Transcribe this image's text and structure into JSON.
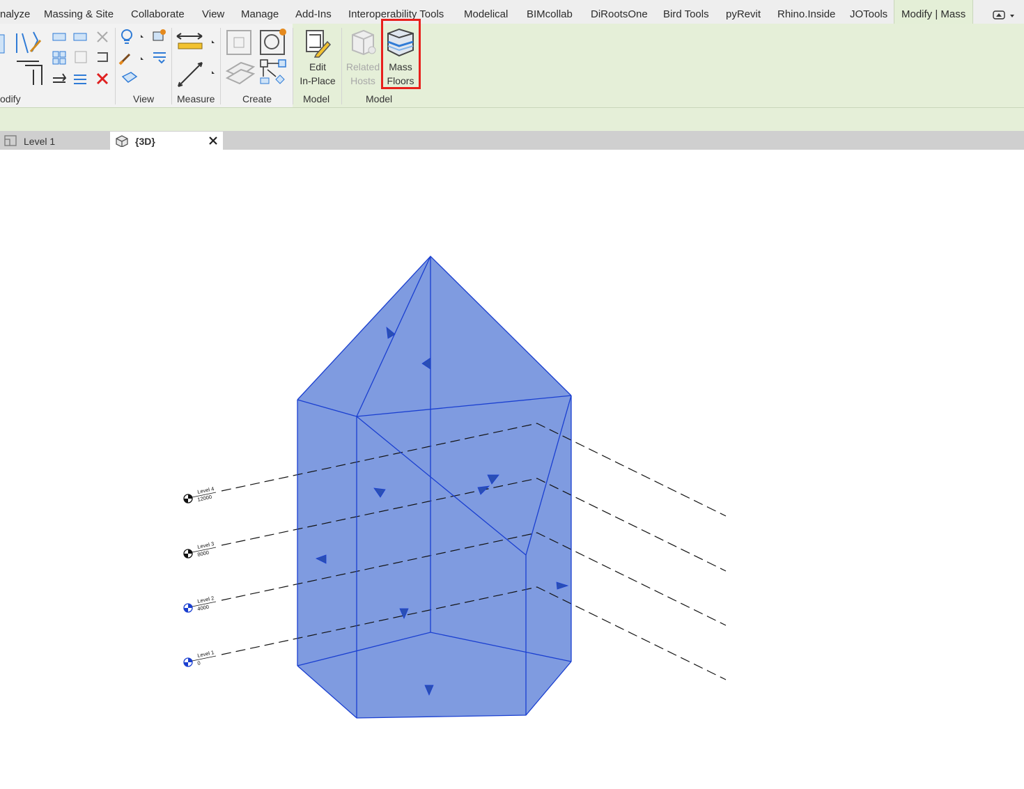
{
  "menu": {
    "tabs": [
      "nalyze",
      "Massing & Site",
      "Collaborate",
      "View",
      "Manage",
      "Add-Ins",
      "Interoperability Tools",
      "Modelical",
      "BIMcollab",
      "DiRootsOne",
      "Bird Tools",
      "pyRevit",
      "Rhino.Inside",
      "JOTools",
      "Modify | Mass"
    ],
    "active": "Modify | Mass"
  },
  "ribbon": {
    "panels": {
      "modify": "odify",
      "view": "View",
      "measure": "Measure",
      "create": "Create",
      "model1": "Model",
      "model2": "Model"
    },
    "buttons": {
      "edit_in_place": [
        "Edit",
        "In-Place"
      ],
      "related_hosts": [
        "Related",
        "Hosts"
      ],
      "mass_floors": [
        "Mass",
        "Floors"
      ]
    },
    "highlight_color": "#e8201c"
  },
  "doc_tabs": {
    "level1": "Level 1",
    "view3d": "{3D}"
  },
  "levels": [
    {
      "name": "Level 4",
      "elevation": "12000"
    },
    {
      "name": "Level 3",
      "elevation": "8000"
    },
    {
      "name": "Level 2",
      "elevation": "4000"
    },
    {
      "name": "Level 1",
      "elevation": "0"
    }
  ],
  "colors": {
    "mass_fill": "#7f9be0",
    "mass_edge": "#1a3fd0",
    "ribbon_context": "#e5efd8"
  }
}
